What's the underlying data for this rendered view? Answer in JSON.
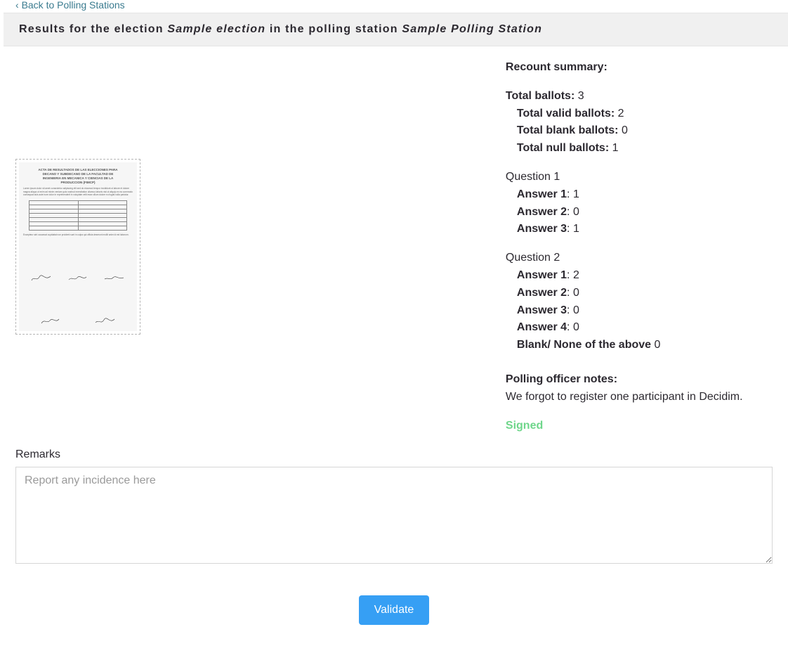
{
  "back_link_text": "Back to Polling Stations",
  "header": {
    "prefix": "Results for the election ",
    "election_name": "Sample election",
    "mid": " in the polling station ",
    "station_name": "Sample Polling Station"
  },
  "summary": {
    "title": "Recount summary:",
    "total_ballots_label": "Total ballots:",
    "total_ballots": "3",
    "valid_label": "Total valid ballots:",
    "valid": "2",
    "blank_label": "Total blank ballots:",
    "blank": "0",
    "null_label": "Total null ballots:",
    "null": "1"
  },
  "questions": [
    {
      "title": "Question 1",
      "answers": [
        {
          "label": "Answer 1",
          "sep": ": ",
          "value": "1"
        },
        {
          "label": "Answer 2",
          "sep": ": ",
          "value": "0"
        },
        {
          "label": "Answer 3",
          "sep": ": ",
          "value": "1"
        }
      ]
    },
    {
      "title": "Question 2",
      "answers": [
        {
          "label": "Answer 1",
          "sep": ": ",
          "value": "2"
        },
        {
          "label": "Answer 2",
          "sep": ": ",
          "value": "0"
        },
        {
          "label": "Answer 3",
          "sep": ": ",
          "value": "0"
        },
        {
          "label": "Answer 4",
          "sep": ": ",
          "value": "0"
        },
        {
          "label": "Blank/ None of the above",
          "sep": " ",
          "value": "0"
        }
      ]
    }
  ],
  "notes": {
    "title": "Polling officer notes:",
    "body": "We forgot to register one participant in Decidim."
  },
  "signed_label": "Signed",
  "remarks": {
    "label": "Remarks",
    "placeholder": "Report any incidence here",
    "value": ""
  },
  "validate_label": "Validate",
  "thumb": {
    "title_lines": [
      "ACTA DE RESULTADOS DE LAS ELECCIONES PARA",
      "DECANO Y SUBDECANO DE LA FACULTAD DE",
      "INGENIERIA EN MECANICA Y CIENCIAS DE LA",
      "PRODUCCION (FIMCP)"
    ]
  }
}
